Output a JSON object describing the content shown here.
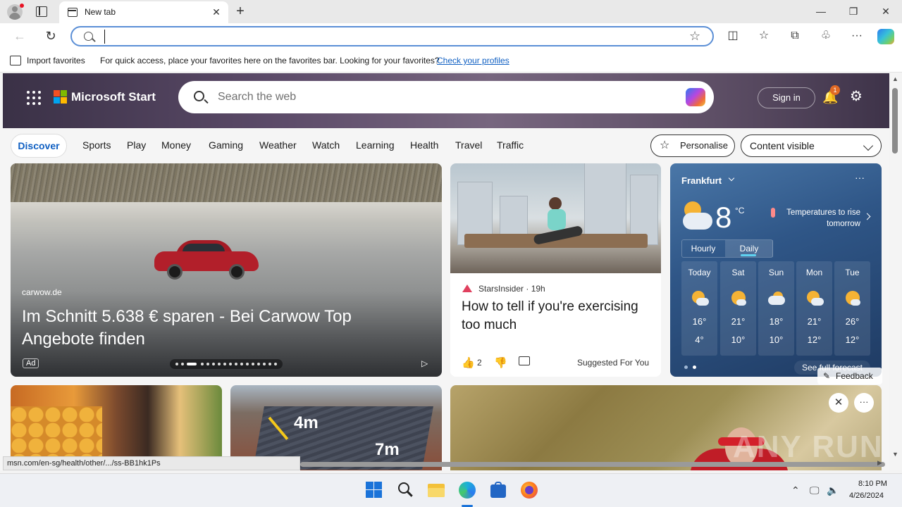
{
  "browser": {
    "tab_title": "New tab",
    "tab_close": "✕",
    "new_tab": "+",
    "minimize": "—",
    "restore": "❐",
    "close": "✕",
    "address_value": "",
    "back": "←",
    "reload": "↻",
    "star": "☆",
    "split_screen": "◫",
    "favorites": "☆",
    "collections": "⧉",
    "extensions": "♧",
    "more": "···"
  },
  "favbar": {
    "import_label": "Import favorites",
    "hint": "For quick access, place your favorites here on the favorites bar. Looking for your favorites?",
    "link": "Check your profiles"
  },
  "msn": {
    "brand": "Microsoft Start",
    "search_placeholder": "Search the web",
    "signin": "Sign in",
    "notifications_count": "1",
    "bell": "🔔",
    "settings": "⚙"
  },
  "nav": {
    "discover": "Discover",
    "items": [
      "Sports",
      "Play",
      "Money",
      "Gaming",
      "Weather",
      "Watch",
      "Learning",
      "Health",
      "Travel",
      "Traffic"
    ],
    "personalise": "Personalise",
    "personalise_icon": "☆",
    "content_visible": "Content visible"
  },
  "hero": {
    "source": "carwow.de",
    "title": "Im Schnitt 5.638 € sparen - Bei Carwow Top Angebote finden",
    "ad_label": "Ad",
    "ad_icon": "▷"
  },
  "article": {
    "source": "StarsInsider · 19h",
    "title": "How to tell if you're exercising too much",
    "like_icon": "👍",
    "likes": "2",
    "dislike_icon": "👎",
    "tag": "Suggested For You"
  },
  "weather": {
    "city": "Frankfurt",
    "more": "···",
    "temperature": "8",
    "unit": "°C",
    "alert": "Temperatures to rise tomorrow",
    "tab_hourly": "Hourly",
    "tab_daily": "Daily",
    "days": [
      {
        "name": "Today",
        "high": "16°",
        "low": "4°",
        "icon": "sun-cloud"
      },
      {
        "name": "Sat",
        "high": "21°",
        "low": "10°",
        "icon": "sun"
      },
      {
        "name": "Sun",
        "high": "18°",
        "low": "10°",
        "icon": "cloud"
      },
      {
        "name": "Mon",
        "high": "21°",
        "low": "12°",
        "icon": "sun-cloud"
      },
      {
        "name": "Tue",
        "high": "26°",
        "low": "12°",
        "icon": "sun"
      }
    ],
    "forecast_link": "See full forecast"
  },
  "cards_row2": {
    "house_label_1": "4m",
    "house_label_2": "7m",
    "close": "✕",
    "more": "···"
  },
  "feedback": {
    "icon": "✎",
    "label": "Feedback"
  },
  "status_url": "msn.com/en-sg/health/other/.../ss-BB1hk1Ps",
  "watermark": "ANY RUN",
  "taskbar": {
    "time": "8:10 PM",
    "date": "4/26/2024",
    "chevron": "⌃",
    "network": "🖵",
    "volume": "🔈"
  },
  "colors": {
    "accent": "#0f5fc2",
    "header_bg": "#5b4a68",
    "weather_bg": "#2f5687",
    "badge": "#e06a25"
  }
}
